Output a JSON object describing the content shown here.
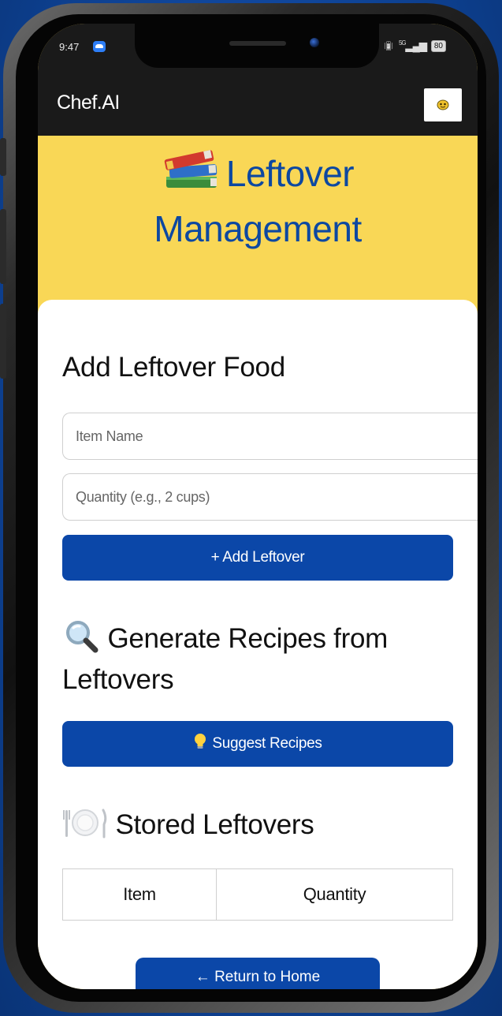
{
  "status_bar": {
    "time": "9:47",
    "network": "5G",
    "battery": "80"
  },
  "app_bar": {
    "brand": "Chef.AI",
    "avatar_icon": "emoji-face-icon"
  },
  "hero": {
    "icon": "books-icon",
    "title_line1": "Leftover",
    "title_line2": "Management"
  },
  "add_section": {
    "title": "Add Leftover Food",
    "item_placeholder": "Item Name",
    "quantity_placeholder": "Quantity (e.g., 2 cups)",
    "add_button": "+ Add Leftover"
  },
  "generate_section": {
    "icon": "magnifier-icon",
    "title": "Generate Recipes from Leftovers",
    "button_icon": "lightbulb-icon",
    "button_label": "Suggest Recipes"
  },
  "stored_section": {
    "icon": "fork-knife-plate-icon",
    "title": "Stored Leftovers",
    "columns": [
      "Item",
      "Quantity"
    ]
  },
  "home_button": {
    "label": "← Return to Home"
  },
  "colors": {
    "accent": "#0b47a8",
    "hero_background": "#f9d756",
    "app_bar": "#1a1a1a",
    "page_background": "#0f4aa3"
  }
}
